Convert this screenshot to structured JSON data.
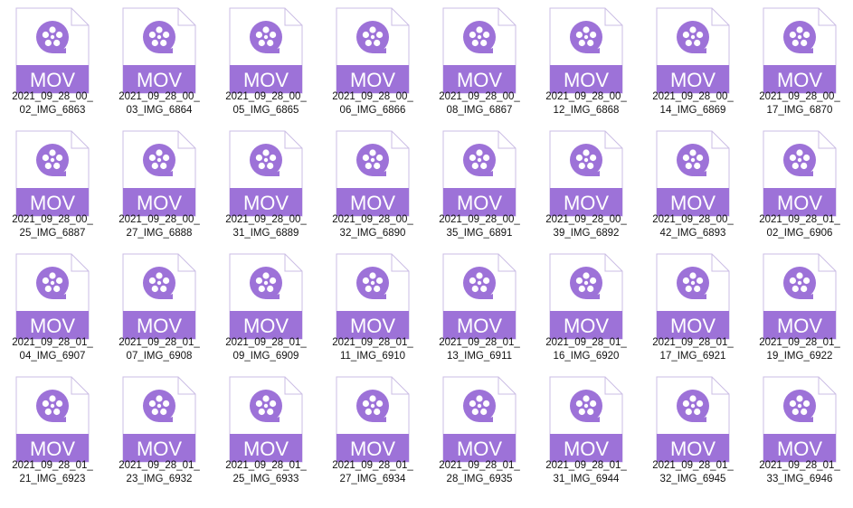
{
  "file_icon": {
    "icon_name": "quicktime-video-file-icon",
    "extension_label": "MOV",
    "accent_color": "#9d72d8",
    "sheet_color": "#ffffff",
    "outline_color": "#cbbde4"
  },
  "files": [
    {
      "line1": "2021_09_28_00_",
      "line2": "02_IMG_6863"
    },
    {
      "line1": "2021_09_28_00_",
      "line2": "03_IMG_6864"
    },
    {
      "line1": "2021_09_28_00_",
      "line2": "05_IMG_6865"
    },
    {
      "line1": "2021_09_28_00_",
      "line2": "06_IMG_6866"
    },
    {
      "line1": "2021_09_28_00_",
      "line2": "08_IMG_6867"
    },
    {
      "line1": "2021_09_28_00_",
      "line2": "12_IMG_6868"
    },
    {
      "line1": "2021_09_28_00_",
      "line2": "14_IMG_6869"
    },
    {
      "line1": "2021_09_28_00_",
      "line2": "17_IMG_6870"
    },
    {
      "line1": "2021_09_28_00_",
      "line2": "25_IMG_6887"
    },
    {
      "line1": "2021_09_28_00_",
      "line2": "27_IMG_6888"
    },
    {
      "line1": "2021_09_28_00_",
      "line2": "31_IMG_6889"
    },
    {
      "line1": "2021_09_28_00_",
      "line2": "32_IMG_6890"
    },
    {
      "line1": "2021_09_28_00_",
      "line2": "35_IMG_6891"
    },
    {
      "line1": "2021_09_28_00_",
      "line2": "39_IMG_6892"
    },
    {
      "line1": "2021_09_28_00_",
      "line2": "42_IMG_6893"
    },
    {
      "line1": "2021_09_28_01_",
      "line2": "02_IMG_6906"
    },
    {
      "line1": "2021_09_28_01_",
      "line2": "04_IMG_6907"
    },
    {
      "line1": "2021_09_28_01_",
      "line2": "07_IMG_6908"
    },
    {
      "line1": "2021_09_28_01_",
      "line2": "09_IMG_6909"
    },
    {
      "line1": "2021_09_28_01_",
      "line2": "11_IMG_6910"
    },
    {
      "line1": "2021_09_28_01_",
      "line2": "13_IMG_6911"
    },
    {
      "line1": "2021_09_28_01_",
      "line2": "16_IMG_6920"
    },
    {
      "line1": "2021_09_28_01_",
      "line2": "17_IMG_6921"
    },
    {
      "line1": "2021_09_28_01_",
      "line2": "19_IMG_6922"
    },
    {
      "line1": "2021_09_28_01_",
      "line2": "21_IMG_6923"
    },
    {
      "line1": "2021_09_28_01_",
      "line2": "23_IMG_6932"
    },
    {
      "line1": "2021_09_28_01_",
      "line2": "25_IMG_6933"
    },
    {
      "line1": "2021_09_28_01_",
      "line2": "27_IMG_6934"
    },
    {
      "line1": "2021_09_28_01_",
      "line2": "28_IMG_6935"
    },
    {
      "line1": "2021_09_28_01_",
      "line2": "31_IMG_6944"
    },
    {
      "line1": "2021_09_28_01_",
      "line2": "32_IMG_6945"
    },
    {
      "line1": "2021_09_28_01_",
      "line2": "33_IMG_6946"
    }
  ]
}
